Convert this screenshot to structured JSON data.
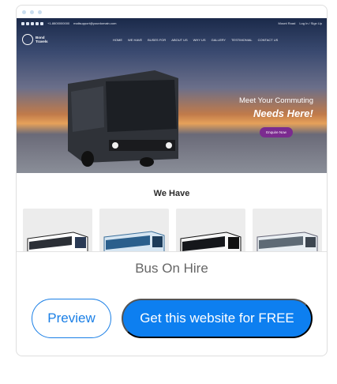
{
  "preview": {
    "topbar": {
      "phone": "+1-8800000000",
      "email": "mailsupport@yourdomain.com",
      "login": "Log In / Sign Up",
      "location": "Mount Road"
    },
    "logo_text": "Bond Travels",
    "menu": [
      "HOME",
      "WE HAVE",
      "BUSES FOR",
      "ABOUT US",
      "WHY US",
      "GALLERY",
      "TESTIMONIAL",
      "CONTACT US"
    ],
    "hero": {
      "line1": "Meet Your Commuting",
      "line2": "Needs Here!",
      "cta": "Enquire Now"
    },
    "section_title": "We Have",
    "colors": {
      "accent": "#0d7ff0",
      "cta": "#7b2b8f"
    }
  },
  "card": {
    "title": "Bus On Hire",
    "preview_label": "Preview",
    "get_label": "Get this website for FREE"
  }
}
